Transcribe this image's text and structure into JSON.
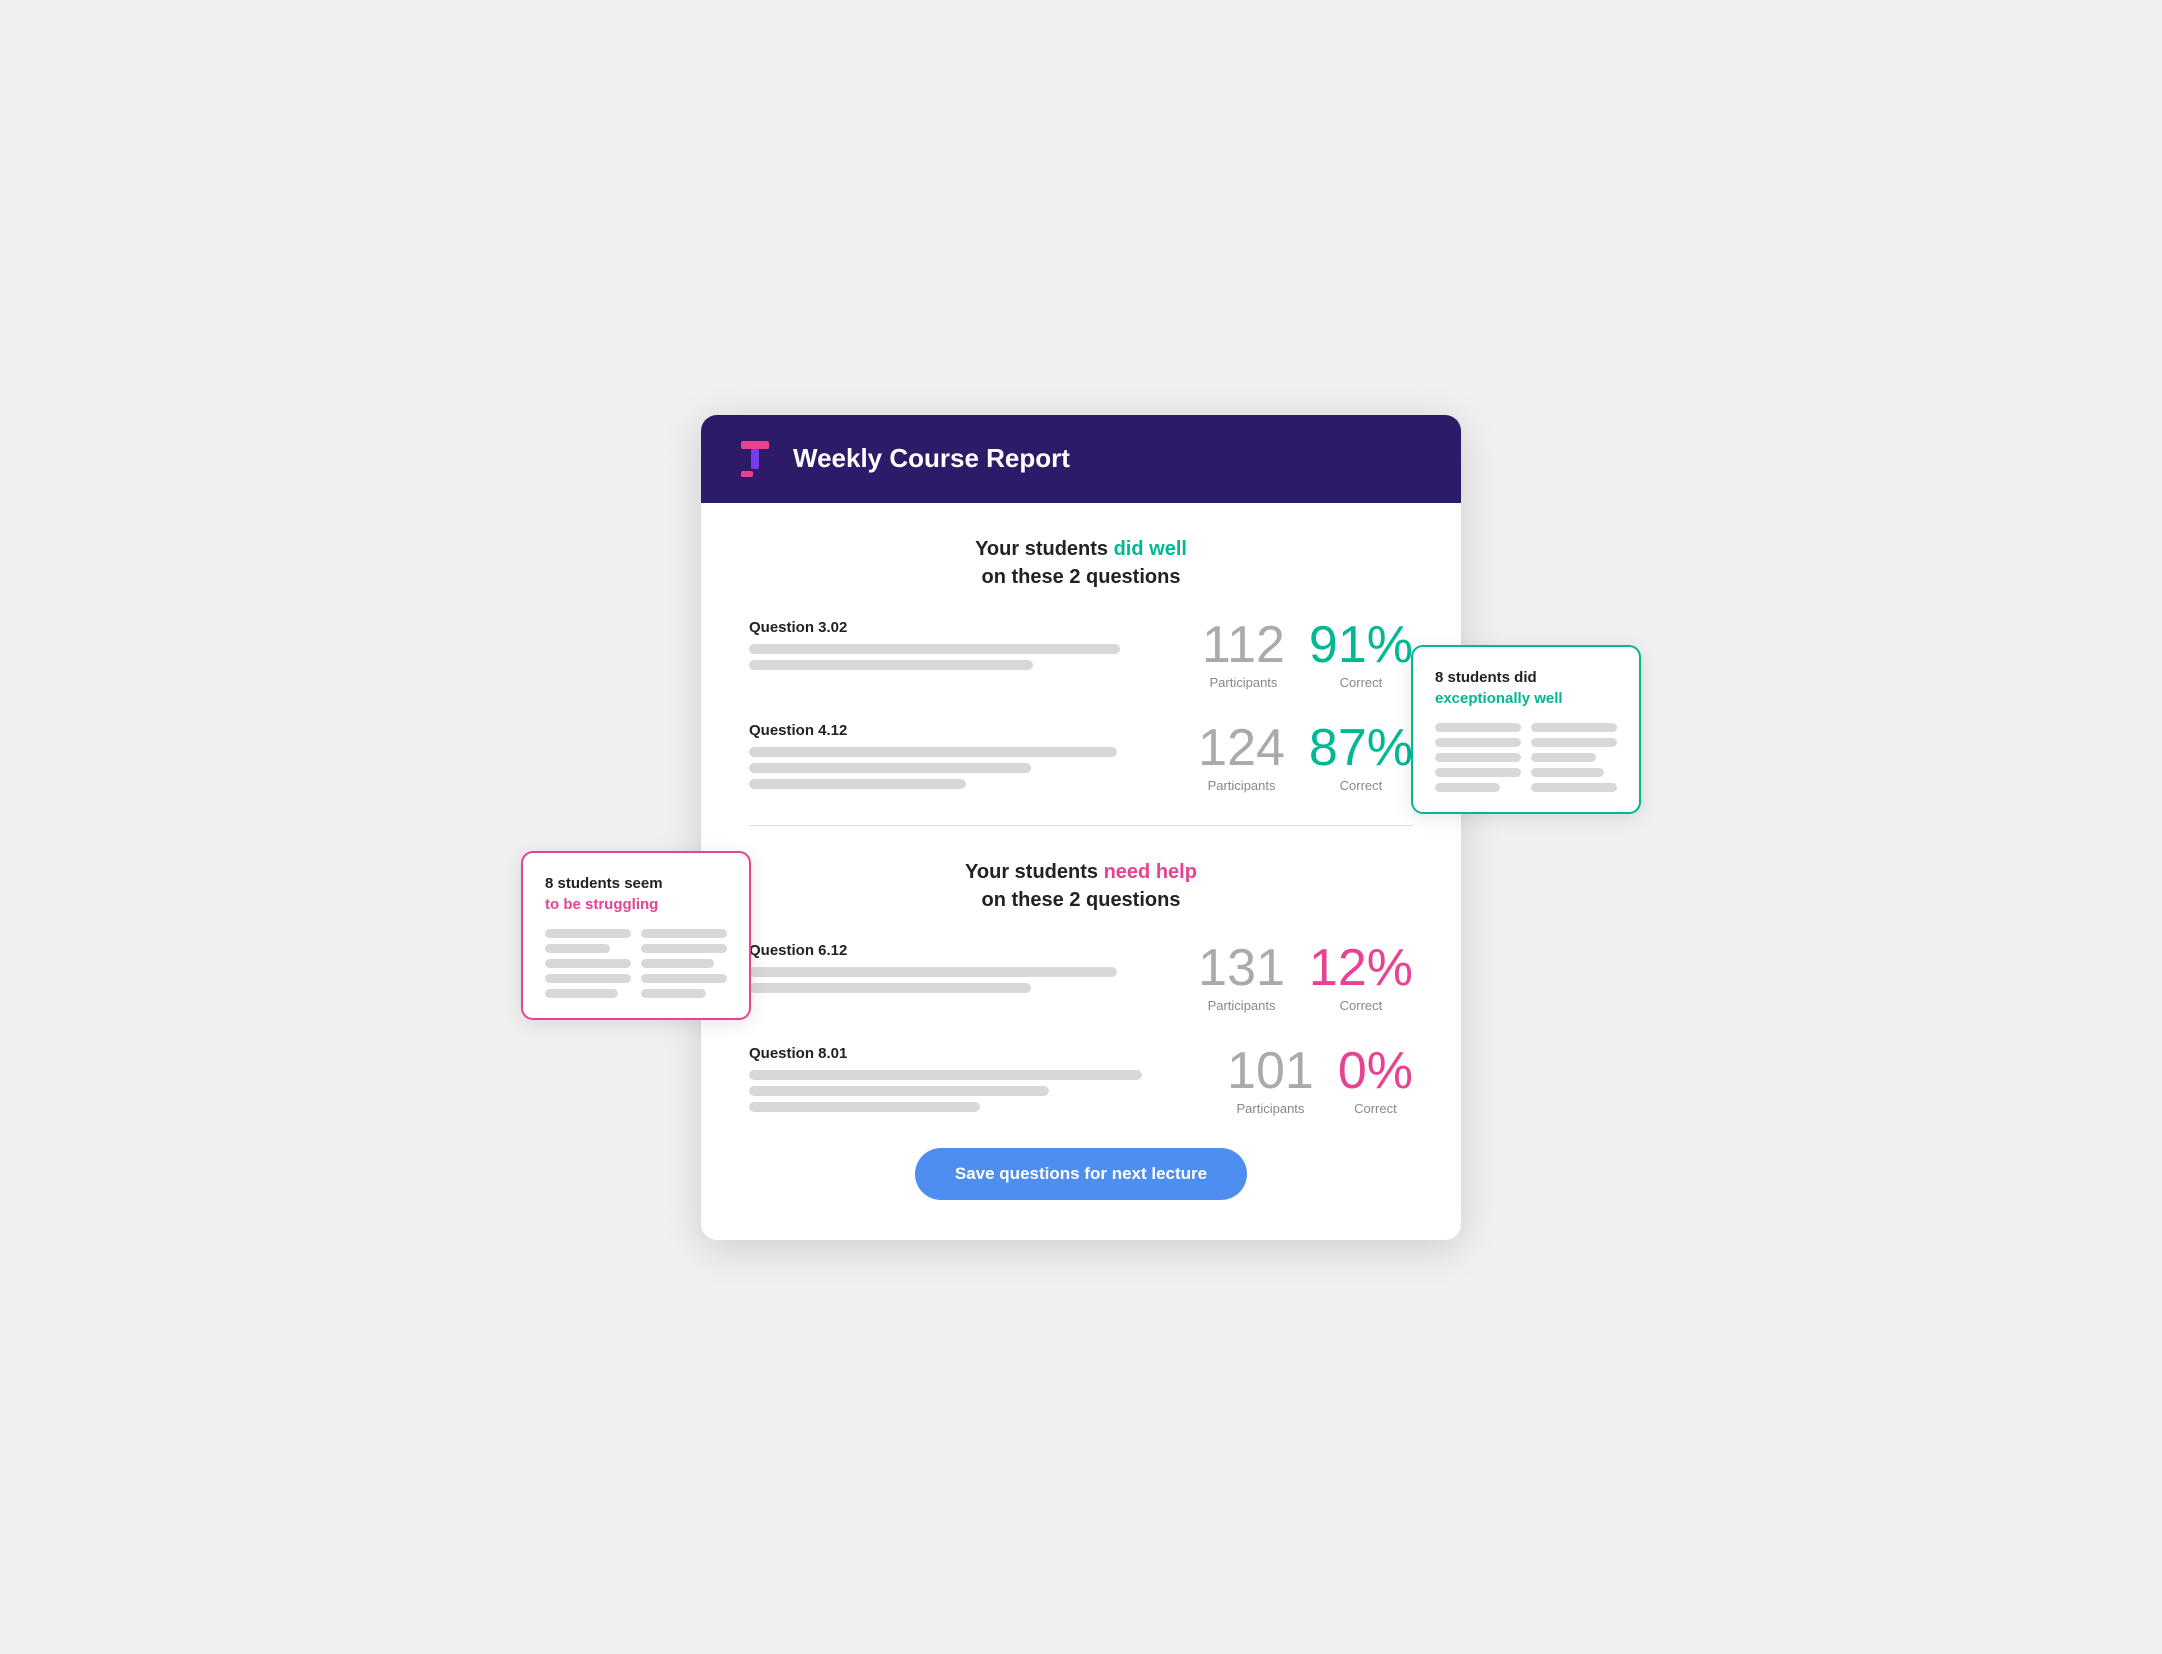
{
  "header": {
    "title": "Weekly Course Report"
  },
  "well_section": {
    "heading_part1": "Your students ",
    "heading_highlight": "did well",
    "heading_part2": "on these 2 questions"
  },
  "struggle_section": {
    "heading_part1": "Your students ",
    "heading_highlight": "need help",
    "heading_part2": "on these 2 questions"
  },
  "questions_well": [
    {
      "label": "Question 3.02",
      "participants": "112",
      "participants_label": "Participants",
      "correct": "91%",
      "correct_label": "Correct"
    },
    {
      "label": "Question 4.12",
      "participants": "124",
      "participants_label": "Participants",
      "correct": "87%",
      "correct_label": "Correct"
    }
  ],
  "questions_struggle": [
    {
      "label": "Question 6.12",
      "participants": "131",
      "participants_label": "Participants",
      "correct": "12%",
      "correct_label": "Correct"
    },
    {
      "label": "Question 8.01",
      "participants": "101",
      "participants_label": "Participants",
      "correct": "0%",
      "correct_label": "Correct"
    }
  ],
  "callout_exceptional": {
    "prefix": "8 students did",
    "highlight": "exceptionally well"
  },
  "callout_struggling": {
    "prefix": "8 students ",
    "middle": "seem",
    "highlight": "to be struggling"
  },
  "save_button": {
    "label": "Save questions for next lecture"
  }
}
